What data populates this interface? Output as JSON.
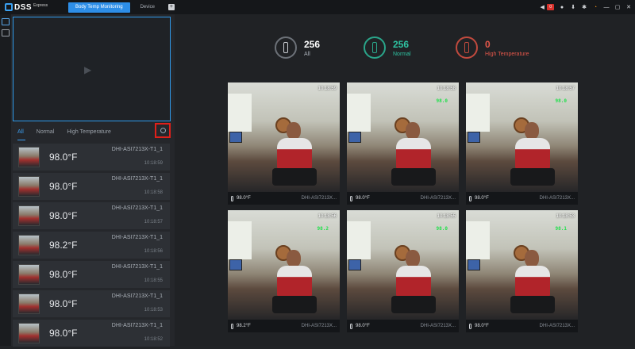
{
  "app": {
    "name": "DSS",
    "sub": "Express"
  },
  "tabs": [
    {
      "label": "Body Temp Monitoring",
      "active": true
    },
    {
      "label": "Device",
      "active": false
    }
  ],
  "topbar": {
    "alarm_count": "0"
  },
  "filters": [
    {
      "label": "All",
      "active": true
    },
    {
      "label": "Normal",
      "active": false
    },
    {
      "label": "High Temperature",
      "active": false
    }
  ],
  "records": [
    {
      "temp": "98.0°F",
      "device": "DHI-ASI7213X-T1_1",
      "time": "10:18:59"
    },
    {
      "temp": "98.0°F",
      "device": "DHI-ASI7213X-T1_1",
      "time": "10:18:58"
    },
    {
      "temp": "98.0°F",
      "device": "DHI-ASI7213X-T1_1",
      "time": "10:18:57"
    },
    {
      "temp": "98.2°F",
      "device": "DHI-ASI7213X-T1_1",
      "time": "10:18:56"
    },
    {
      "temp": "98.0°F",
      "device": "DHI-ASI7213X-T1_1",
      "time": "10:18:55"
    },
    {
      "temp": "98.0°F",
      "device": "DHI-ASI7213X-T1_1",
      "time": "10:18:53"
    },
    {
      "temp": "98.0°F",
      "device": "DHI-ASI7213X-T1_1",
      "time": "10:18:52"
    }
  ],
  "stats": {
    "all": {
      "value": "256",
      "label": "All"
    },
    "normal": {
      "value": "256",
      "label": "Normal"
    },
    "high": {
      "value": "0",
      "label": "High Temperature"
    }
  },
  "snapshots": [
    {
      "time": "10:18:59",
      "overlay": "",
      "temp": "98.0°F",
      "device": "DHI-ASI7213X..."
    },
    {
      "time": "10:18:58",
      "overlay": "98.0",
      "temp": "98.0°F",
      "device": "DHI-ASI7213X..."
    },
    {
      "time": "10:18:57",
      "overlay": "98.0",
      "temp": "98.0°F",
      "device": "DHI-ASI7213X..."
    },
    {
      "time": "10:18:56",
      "overlay": "98.2",
      "temp": "98.2°F",
      "device": "DHI-ASI7213X..."
    },
    {
      "time": "10:18:55",
      "overlay": "98.0",
      "temp": "98.0°F",
      "device": "DHI-ASI7213X..."
    },
    {
      "time": "10:18:53",
      "overlay": "98.1",
      "temp": "98.0°F",
      "device": "DHI-ASI7213X..."
    }
  ],
  "colors": {
    "accent": "#2d8ee8",
    "normal": "#2ec3a2",
    "high": "#e4574a",
    "alarm": "#d9312b"
  }
}
